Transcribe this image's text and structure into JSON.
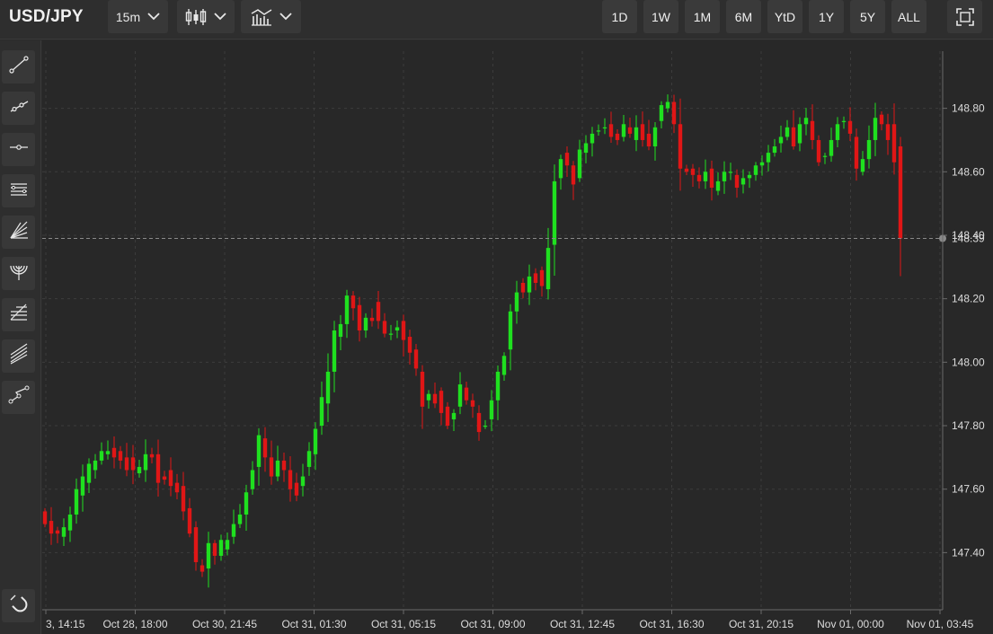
{
  "header": {
    "symbol": "USD/JPY",
    "interval": "15m",
    "chart_type_icon": "candlestick-icon",
    "indicators_icon": "indicators-icon",
    "ranges": [
      "1D",
      "1W",
      "1M",
      "6M",
      "YtD",
      "1Y",
      "5Y",
      "ALL"
    ],
    "fullscreen_icon": "fullscreen-icon"
  },
  "tools": [
    "trend-line-icon",
    "ray-icon",
    "horizontal-line-icon",
    "parallel-channel-icon",
    "fan-icon",
    "arc-icon",
    "fibonacci-retracement-icon",
    "pitchfork-icon",
    "path-icon",
    "magnet-icon"
  ],
  "colors": {
    "up": "#1fe01f",
    "down": "#e01616",
    "background": "#282828",
    "grid": "#3c3c3c",
    "crosshair": "#8a8a8a"
  },
  "chart_data": {
    "type": "candlestick",
    "title": "USD/JPY",
    "interval": "15m",
    "y_ticks": [
      "147.40",
      "147.60",
      "147.80",
      "148.00",
      "148.20",
      "148.40",
      "148.60",
      "148.80"
    ],
    "ylim": [
      147.22,
      148.98
    ],
    "x_labels": [
      "3, 14:15",
      "Oct 28, 18:00",
      "Oct 30, 21:45",
      "Oct 31, 01:30",
      "Oct 31, 05:15",
      "Oct 31, 09:00",
      "Oct 31, 12:45",
      "Oct 31, 16:30",
      "Oct 31, 20:15",
      "Nov 01, 00:00",
      "Nov 01, 03:45"
    ],
    "last_price": "148.39",
    "last_value": 148.39,
    "grid": true,
    "open": [
      147.53,
      147.5,
      147.47,
      147.45,
      147.47,
      147.52,
      147.58,
      147.62,
      147.66,
      147.69,
      147.71,
      147.73,
      147.72,
      147.7,
      147.7,
      147.65,
      147.66,
      147.71,
      147.71,
      147.64,
      147.66,
      147.62,
      147.61,
      147.54,
      147.48,
      147.36,
      147.35,
      147.43,
      147.39,
      147.41,
      147.45,
      147.49,
      147.52,
      147.6,
      147.67,
      147.76,
      147.7,
      147.64,
      147.69,
      147.66,
      147.62,
      147.61,
      147.67,
      147.71,
      147.8,
      147.87,
      147.97,
      148.08,
      148.12,
      148.21,
      148.18,
      148.1,
      148.14,
      148.19,
      148.13,
      148.09,
      148.1,
      148.13,
      148.08,
      148.04,
      147.97,
      147.88,
      147.9,
      147.91,
      147.86,
      147.82,
      147.86,
      147.92,
      147.88,
      147.84,
      147.8,
      147.82,
      147.88,
      147.96,
      148.04,
      148.16,
      148.25,
      148.22,
      148.28,
      148.29,
      148.23,
      148.37,
      148.58,
      148.66,
      148.62,
      148.58,
      148.66,
      148.69,
      148.73,
      148.74,
      148.75,
      148.72,
      148.71,
      148.74,
      148.7,
      148.75,
      148.72,
      148.68,
      148.76,
      148.8,
      148.82,
      148.75,
      148.61,
      148.61,
      148.59,
      148.57,
      148.61,
      148.54,
      148.57,
      148.6,
      148.59,
      148.56,
      148.58,
      148.59,
      148.62,
      148.63,
      148.66,
      148.69,
      148.71,
      148.74,
      148.69,
      148.75,
      148.76,
      148.7,
      148.65,
      148.65,
      148.7,
      148.76,
      148.76,
      148.71,
      148.6,
      148.64,
      148.7,
      148.78,
      148.75,
      148.75,
      148.68
    ],
    "close": [
      147.49,
      147.46,
      147.46,
      147.48,
      147.52,
      147.6,
      147.64,
      147.68,
      147.69,
      147.72,
      147.72,
      147.7,
      147.69,
      147.66,
      147.66,
      147.67,
      147.71,
      147.7,
      147.62,
      147.63,
      147.61,
      147.59,
      147.53,
      147.46,
      147.37,
      147.34,
      147.43,
      147.39,
      147.44,
      147.44,
      147.49,
      147.52,
      147.59,
      147.66,
      147.77,
      147.7,
      147.64,
      147.69,
      147.66,
      147.6,
      147.58,
      147.64,
      147.72,
      147.79,
      147.89,
      147.97,
      148.1,
      148.12,
      148.21,
      148.17,
      148.1,
      148.14,
      148.13,
      148.13,
      148.09,
      148.09,
      148.11,
      148.07,
      148.03,
      147.98,
      147.86,
      147.9,
      147.87,
      147.84,
      147.8,
      147.84,
      147.93,
      147.88,
      147.86,
      147.78,
      147.8,
      147.88,
      147.97,
      148.02,
      148.16,
      148.22,
      148.22,
      148.27,
      148.25,
      148.24,
      148.36,
      148.57,
      148.64,
      148.62,
      148.56,
      148.67,
      148.69,
      148.72,
      148.73,
      148.74,
      148.71,
      148.7,
      148.75,
      148.72,
      148.74,
      148.7,
      148.68,
      148.74,
      148.81,
      148.82,
      148.75,
      148.61,
      148.6,
      148.59,
      148.57,
      148.6,
      148.55,
      148.57,
      148.6,
      148.6,
      148.55,
      148.58,
      148.59,
      148.62,
      148.63,
      148.66,
      148.68,
      148.71,
      148.74,
      148.68,
      148.75,
      148.77,
      148.7,
      148.63,
      148.65,
      148.7,
      148.75,
      148.76,
      148.72,
      148.61,
      148.64,
      148.7,
      148.77,
      148.75,
      148.7,
      148.63,
      148.39
    ]
  }
}
